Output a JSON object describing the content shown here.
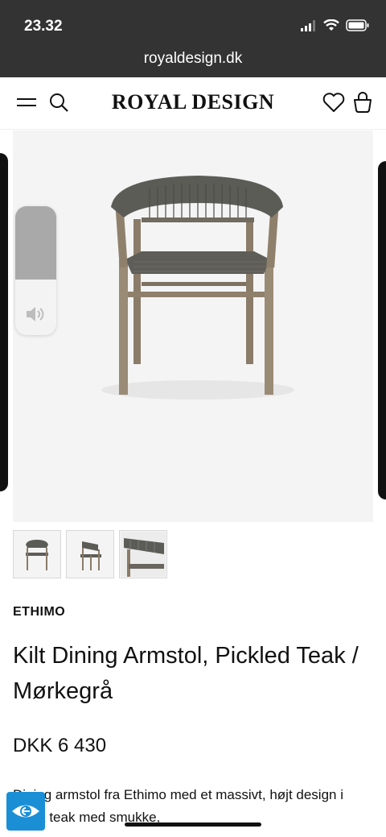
{
  "status": {
    "time": "23.32"
  },
  "browser": {
    "url": "royaldesign.dk"
  },
  "header": {
    "logo": "ROYAL DESIGN"
  },
  "product": {
    "brand": "ETHIMO",
    "title": "Kilt Dining Armstol, Pickled Teak / Mørkegrå",
    "price": "DKK 6 430",
    "description": "Dining armstol fra Ethimo med et massivt, højt design i smuk teak med smukke,"
  },
  "gallery": {
    "thumbnail_count": 3
  },
  "volume": {
    "level_percent": 57
  },
  "colors": {
    "status_bar": "#333333",
    "accessibility": "#1a8fd6",
    "hero_bg": "#f4f4f4"
  },
  "icons": [
    "menu-icon",
    "search-icon",
    "heart-icon",
    "bag-icon",
    "speaker-icon",
    "eye-icon",
    "wifi-icon",
    "battery-icon",
    "signal-icon"
  ]
}
